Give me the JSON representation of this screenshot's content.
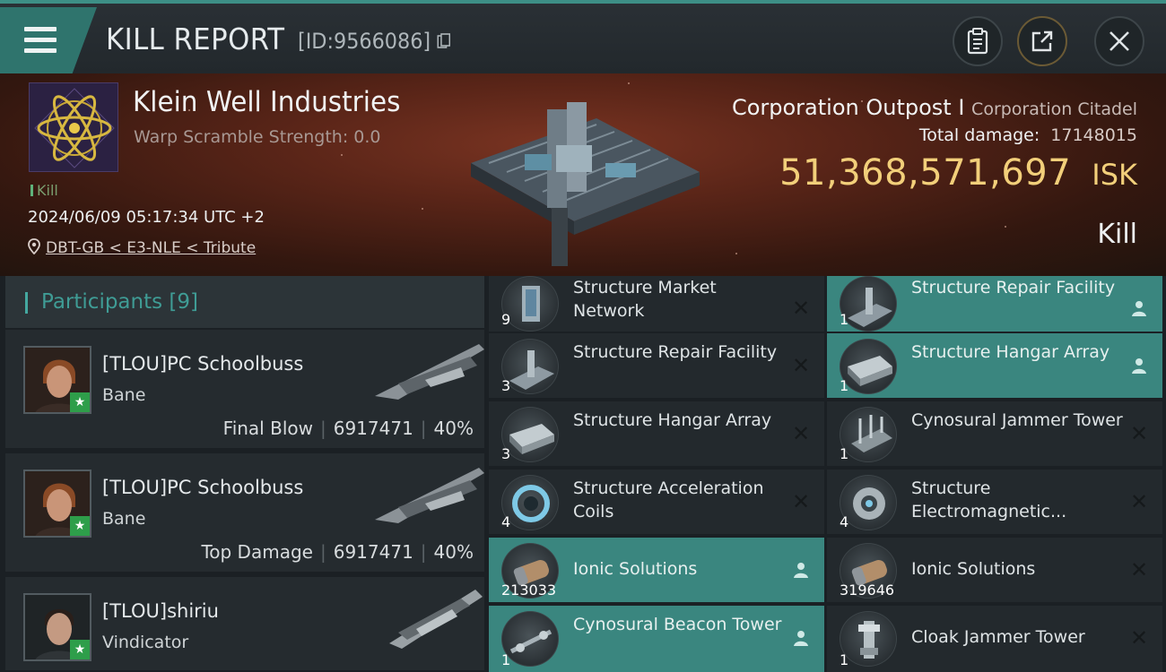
{
  "header": {
    "title": "KILL REPORT",
    "report_id": "[ID:9566086]"
  },
  "victim": {
    "corp_name": "Klein Well Industries",
    "warp_scramble": "Warp Scramble Strength: 0.0",
    "kill_tag": "Kill",
    "datetime": "2024/06/09 05:17:34 UTC +2",
    "location": "DBT-GB < E3-NLE < Tribute",
    "structure_name": "Corporation Outpost I",
    "structure_type": "Corporation Citadel",
    "total_damage_label": "Total damage:",
    "total_damage": "17148015",
    "isk_value": "51,368,571,697",
    "isk_unit": "ISK",
    "result": "Kill"
  },
  "participants": {
    "label": "Participants",
    "count": "[9]",
    "items": [
      {
        "name": "[TLOU]PC Schoolbuss",
        "ship": "Bane",
        "role": "Final Blow",
        "damage": "6917471",
        "pct": "40%"
      },
      {
        "name": "[TLOU]PC Schoolbuss",
        "ship": "Bane",
        "role": "Top Damage",
        "damage": "6917471",
        "pct": "40%"
      },
      {
        "name": "[TLOU]shiriu",
        "ship": "Vindicator"
      }
    ]
  },
  "items_left": [
    {
      "name": "Structure Market Network",
      "qty": "9",
      "state": "destroyed",
      "icon": "market-network-icon"
    },
    {
      "name": "Structure Repair Facility",
      "qty": "3",
      "state": "destroyed",
      "icon": "repair-facility-icon"
    },
    {
      "name": "Structure Hangar Array",
      "qty": "3",
      "state": "destroyed",
      "icon": "hangar-array-icon"
    },
    {
      "name": "Structure Acceleration Coils",
      "qty": "4",
      "state": "destroyed",
      "icon": "acceleration-coils-icon"
    },
    {
      "name": "Ionic Solutions",
      "qty": "213033",
      "state": "dropped",
      "icon": "ionic-solutions-icon"
    },
    {
      "name": "Cynosural Beacon Tower",
      "qty": "1",
      "state": "dropped",
      "icon": "beacon-tower-icon"
    }
  ],
  "items_right": [
    {
      "name": "Structure Repair Facility",
      "qty": "1",
      "state": "dropped",
      "icon": "repair-facility-icon"
    },
    {
      "name": "Structure Hangar Array",
      "qty": "1",
      "state": "dropped",
      "icon": "hangar-array-icon"
    },
    {
      "name": "Cynosural Jammer Tower",
      "qty": "1",
      "state": "destroyed",
      "icon": "jammer-tower-icon"
    },
    {
      "name": "Structure Electromagnetic...",
      "qty": "4",
      "state": "destroyed",
      "icon": "electromagnetic-icon"
    },
    {
      "name": "Ionic Solutions",
      "qty": "319646",
      "state": "destroyed",
      "icon": "ionic-solutions-icon"
    },
    {
      "name": "Cloak Jammer Tower",
      "qty": "1",
      "state": "destroyed",
      "icon": "cloak-jammer-icon"
    }
  ],
  "colors": {
    "accent": "#3a867f",
    "isk": "#f2cf7a",
    "badge": "#2e9e4a"
  }
}
